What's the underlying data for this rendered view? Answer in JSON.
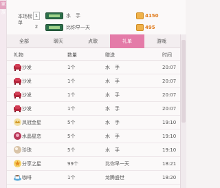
{
  "side_tab": "家族",
  "ranking": {
    "title": "本场榜单",
    "rows": [
      {
        "rank": "1",
        "name": "水　手",
        "coins": "4150"
      },
      {
        "rank": "2",
        "name": "比你早一天",
        "coins": "495"
      }
    ]
  },
  "tabs": [
    {
      "label": "全部"
    },
    {
      "label": "聊天"
    },
    {
      "label": "点歌"
    },
    {
      "label": "礼单"
    },
    {
      "label": "游戏"
    }
  ],
  "table": {
    "headers": [
      "礼物",
      "数量",
      "赠送",
      "时间"
    ],
    "rows": [
      {
        "icon": "sofa-icon",
        "gift": "沙发",
        "qty": "1个",
        "from": "水　手",
        "time": "20:07"
      },
      {
        "icon": "sofa-icon",
        "gift": "沙发",
        "qty": "1个",
        "from": "水　手",
        "time": "20:07"
      },
      {
        "icon": "sofa-icon",
        "gift": "沙发",
        "qty": "1个",
        "from": "水　手",
        "time": "20:07"
      },
      {
        "icon": "sofa-icon",
        "gift": "沙发",
        "qty": "1个",
        "from": "水　手",
        "time": "20:07"
      },
      {
        "icon": "crown-icon",
        "gift": "凤冠金星",
        "qty": "5个",
        "from": "水　手",
        "time": "19:10"
      },
      {
        "icon": "crystal-icon",
        "gift": "水晶星恋",
        "qty": "5个",
        "from": "水　手",
        "time": "19:10"
      },
      {
        "icon": "pearl-icon",
        "gift": "珍珠",
        "qty": "5个",
        "from": "水　手",
        "time": "19:10"
      },
      {
        "icon": "share-star-icon",
        "gift": "分享之星",
        "qty": "99个",
        "from": "比你早一天",
        "time": "18:21"
      },
      {
        "icon": "coffee-icon",
        "gift": "咖啡",
        "qty": "1个",
        "from": "龙腾盛世",
        "time": "18:20"
      }
    ]
  },
  "colors": {
    "accent": "#e47ba8",
    "coin": "#e07a1a"
  }
}
